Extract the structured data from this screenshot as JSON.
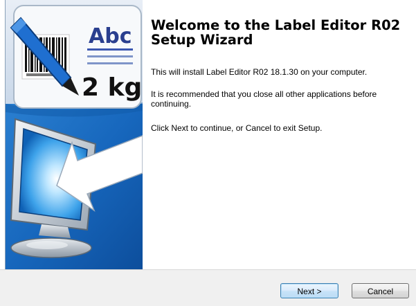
{
  "wizard": {
    "title": "Welcome to the Label Editor R02 Setup Wizard",
    "paragraphs": [
      "This will install Label Editor R02 18.1.30 on your computer.",
      "It is recommended that you close all other applications before continuing.",
      "Click Next to continue, or Cancel to exit Setup."
    ]
  },
  "sidebar_image": {
    "label_text": "Abc",
    "weight_text": "2 kg",
    "icons": [
      "pen-icon",
      "barcode-icon",
      "monitor-icon",
      "arrow-icon"
    ]
  },
  "buttons": {
    "next_label": "Next >",
    "cancel_label": "Cancel"
  },
  "colors": {
    "sidebar_blue": "#1565b8",
    "sidebar_light": "#d9e6f3",
    "label_accent": "#2a3f8f",
    "footer_bg": "#f0f0f0"
  }
}
